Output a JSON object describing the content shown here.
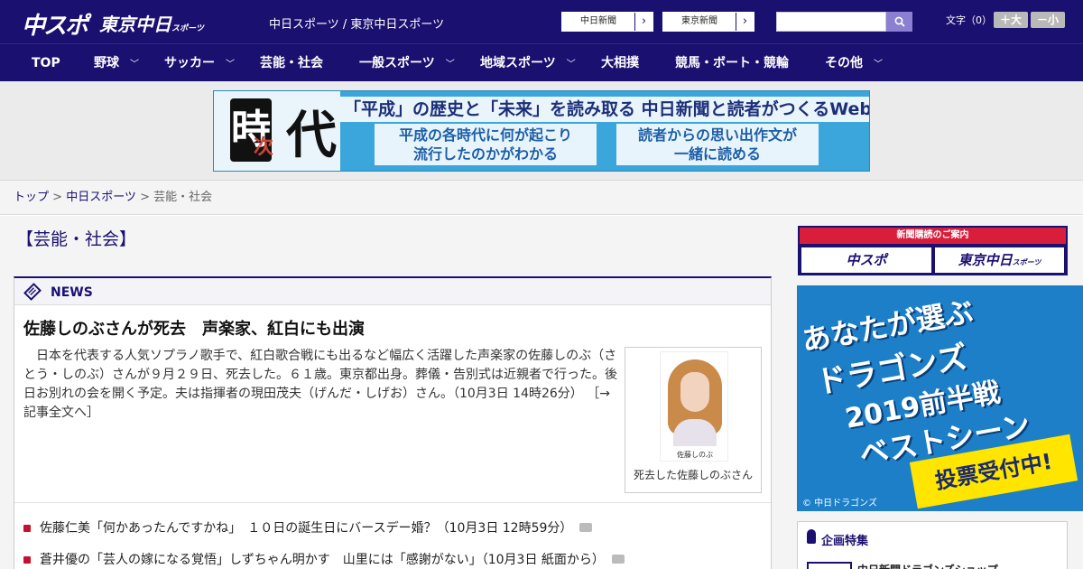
{
  "header": {
    "logo_chuspo": "中スポ",
    "logo_tokyo": "東京中日",
    "logo_tokyo_small": "スポーツ",
    "site_link_1": "中日スポーツ",
    "site_link_sep": " / ",
    "site_link_2": "東京中日スポーツ",
    "paper_btn_1": "中日新聞",
    "paper_btn_2": "東京新聞",
    "search_placeholder": "",
    "font_size_label": "文字（0）",
    "font_larger": "＋大",
    "font_smaller": "－小"
  },
  "nav": {
    "items": [
      {
        "label": "TOP"
      },
      {
        "label": "野球"
      },
      {
        "label": "サッカー"
      },
      {
        "label": "芸能・社会"
      },
      {
        "label": "一般スポーツ"
      },
      {
        "label": "地域スポーツ"
      },
      {
        "label": "大相撲"
      },
      {
        "label": "競馬・ボート・競輪"
      },
      {
        "label": "その他"
      }
    ]
  },
  "banner": {
    "ji": "時",
    "ji_sub": "次",
    "dai": "代",
    "headline": "「平成」の歴史と「未来」を読み取る  中日新聞と読者がつくるWebサイト",
    "box1_line1": "平成の各時代に何が起こり",
    "box1_line2": "流行したのかがわかる",
    "box2_line1": "読者からの思い出作文が",
    "box2_line2": "一緒に読める"
  },
  "breadcrumb": {
    "top": "トップ",
    "sep": " > ",
    "chunichi": "中日スポーツ",
    "current": "芸能・社会"
  },
  "section_title": "【芸能・社会】",
  "news": {
    "label": "NEWS",
    "article": {
      "title": "佐藤しのぶさんが死去　声楽家、紅白にも出演",
      "body": "日本を代表する人気ソプラノ歌手で、紅白歌合戦にも出るなど幅広く活躍した声楽家の佐藤しのぶ（さとう・しのぶ）さんが９月２９日、死去した。６１歳。東京都出身。葬儀・告別式は近親者で行った。後日お別れの会を開く予定。夫は指揮者の現田茂夫（げんだ・しげお）さん。（10月3日 14時26分）",
      "more": "［→記事全文へ］",
      "photo_name": "佐藤しのぶ",
      "photo_caption": "死去した佐藤しのぶさん"
    },
    "items": [
      {
        "text": "佐藤仁美「何かあったんですかね」　１０日の誕生日にバースデー婚？（10月3日 12時59分）"
      },
      {
        "text": "蒼井優の「芸人の嫁になる覚悟」しずちゃん明かす　山里には「感謝がない」（10月3日 紙面から）"
      }
    ]
  },
  "sidebar": {
    "subscribe_head": "新聞購読のご案内",
    "sub_btn_1": "中スポ",
    "sub_btn_2": "東京中日",
    "sub_btn_2_small": "スポーツ",
    "ad_line1": "あなたが選ぶ",
    "ad_line2": "ドラゴンズ",
    "ad_line3": "2019前半戦",
    "ad_line4": "ベストシーン",
    "ad_vote": "投票受付中!",
    "ad_credit": "© 中日ドラゴンズ",
    "feature_title": "企画特集",
    "feature_item": "中日新聞ドラゴンズショップ"
  },
  "colors": {
    "navy": "#1a1070",
    "red_accent": "#c8102e",
    "banner_blue": "#3aa6dc",
    "ad_blue": "#1d7fc8"
  }
}
